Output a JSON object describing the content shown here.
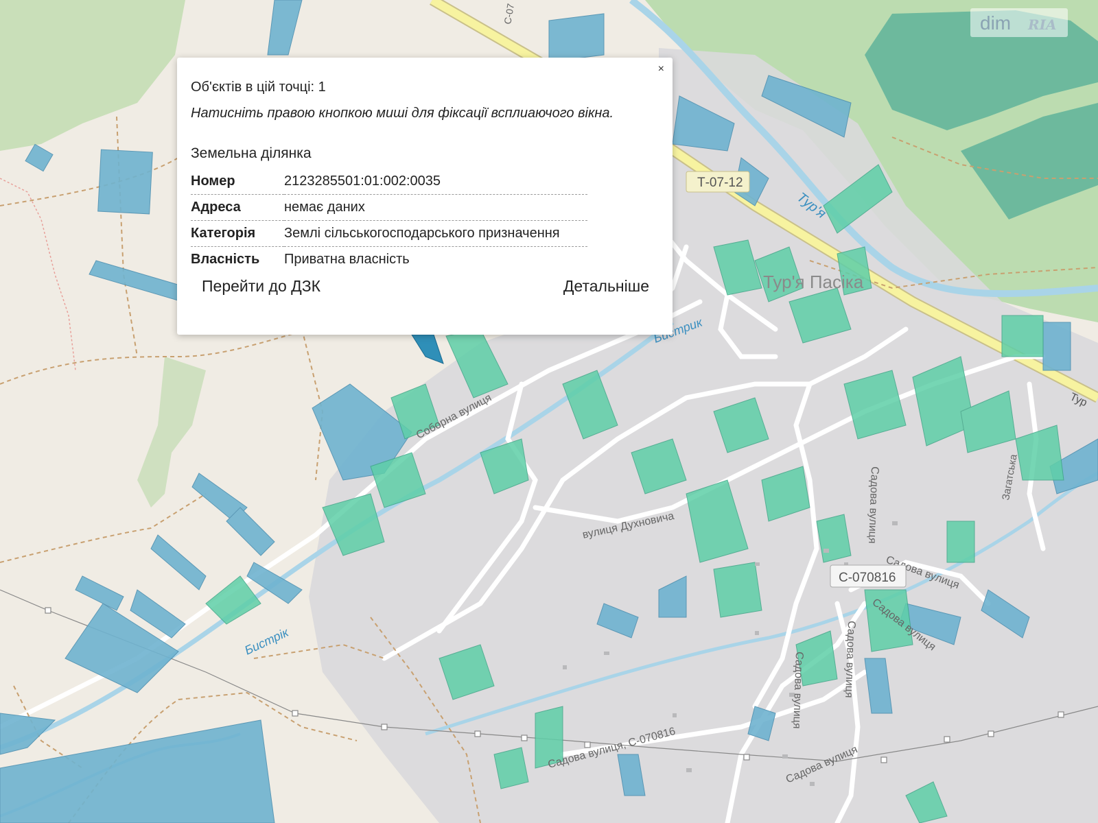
{
  "popup": {
    "close": "×",
    "objects_count": "Об'єктів в цій точці: 1",
    "hint": "Натисніть правою кнопкою миші для фіксації всплиаючого вікна.",
    "heading": "Земельна ділянка",
    "rows": [
      {
        "key": "Номер",
        "value": "2123285501:01:002:0035"
      },
      {
        "key": "Адреса",
        "value": "немає даних"
      },
      {
        "key": "Категорія",
        "value": "Землі сільськогосподарського призначення"
      },
      {
        "key": "Власність",
        "value": "Приватна власність"
      }
    ],
    "btn_dzk": "Перейти до ДЗК",
    "btn_more": "Детальніше"
  },
  "logo": {
    "dim": "dim",
    "ria": "RIA"
  },
  "map": {
    "labels": {
      "village": "Тур'я Пасіка",
      "river_tur": "Тур'я",
      "river_bystryk_1": "Бистрик",
      "river_bystryk_2": "Бистрік",
      "road_t0712": "Т-07-12",
      "road_c070816": "С-070816",
      "sadova_c": "Садова вулиця, С-070816",
      "sobornа": "Соборна вулиця",
      "dukhnovycha": "вулиця Духновича",
      "sadova": "Садова вулиця",
      "zagat": "Загатська",
      "road_c07_top": "С-07",
      "road_tur_edge": "Тур"
    },
    "colors": {
      "background": "#f0ece4",
      "forest": "#bcdcb0",
      "settlement": "#dcdcdc",
      "parcel_blue": "#6fb3d0",
      "parcel_green": "#5fcfa8",
      "main_road": "#f7f3a0",
      "water": "#a9d4e8"
    }
  }
}
